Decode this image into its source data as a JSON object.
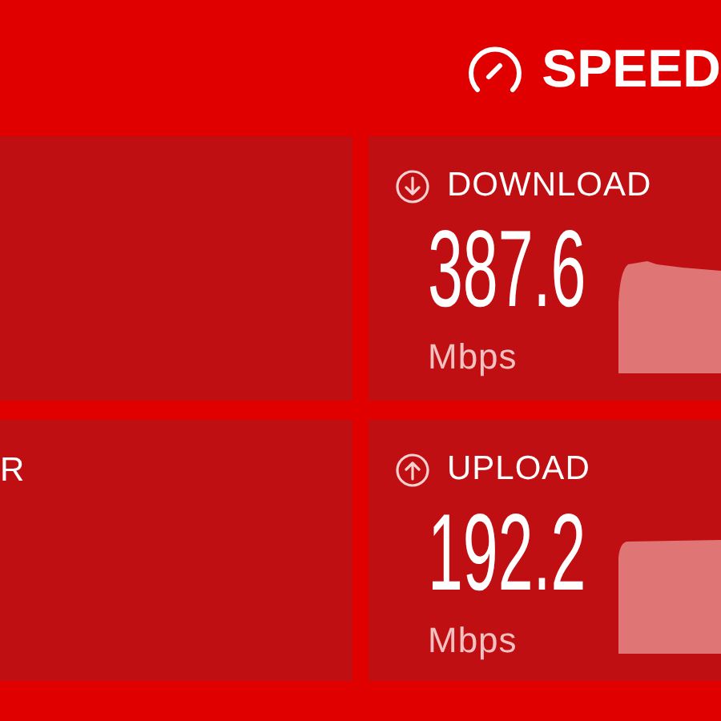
{
  "header": {
    "logo_text": "SPEED"
  },
  "panels": [
    {
      "kind": "blank"
    },
    {
      "kind": "metric",
      "icon": {
        "kind": "down"
      },
      "label": "DOWNLOAD",
      "value": "387.6",
      "unit": "Mbps"
    },
    {
      "kind": "partial",
      "label": "R"
    },
    {
      "kind": "metric",
      "icon": {
        "kind": "up"
      },
      "label": "UPLOAD",
      "value": "192.2",
      "unit": "Mbps"
    }
  ]
}
